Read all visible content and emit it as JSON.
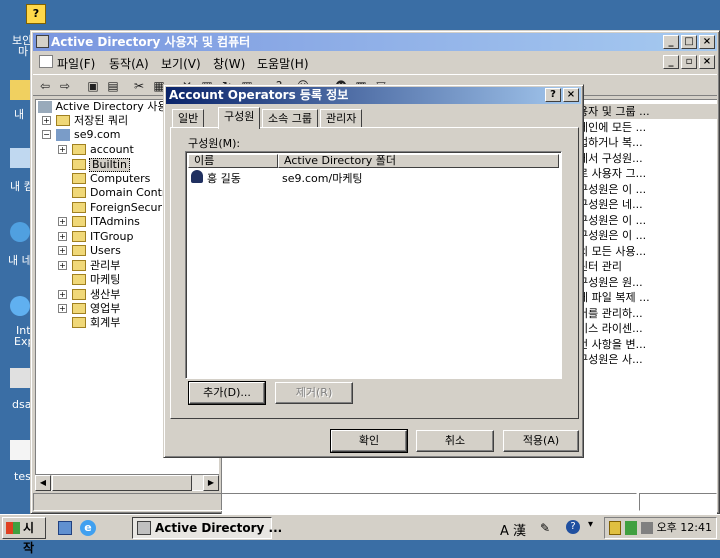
{
  "desktop": {
    "labels": [
      "보안",
      "마",
      "내",
      "내 컴",
      "내 네",
      "Int",
      "Exp",
      "dsa",
      "tes"
    ]
  },
  "mmc": {
    "title": "Active Directory 사용자 및 컴퓨터",
    "menu": [
      "파일(F)",
      "동작(A)",
      "보기(V)",
      "창(W)",
      "도움말(H)"
    ],
    "tree": {
      "root": "Active Directory 사용자",
      "saved_queries": "저장된 쿼리",
      "domain": "se9.com",
      "items": [
        "account",
        "Builtin",
        "Computers",
        "Domain Contro",
        "ForeignSecurit",
        "ITAdmins",
        "ITGroup",
        "Users",
        "관리부",
        "마케팅",
        "생산부",
        "영업부",
        "회계부"
      ]
    },
    "descriptions": [
      "용자 및 그룹 ...",
      "메인에 모든 ...",
      "업하거나 복...",
      "에서 구성원...",
      "로 사용자 그...",
      "구성원은 이 ...",
      "구성원은 네...",
      "구성원은 이 ...",
      "구성원은 이 ...",
      "의 모든 사용...",
      "린터 관리",
      "구성원은 원...",
      "에 파일 복제 ...",
      "버를 관리하...",
      "비스 라이센...",
      "번 사항을 변...",
      "구성원은 사..."
    ]
  },
  "dialog": {
    "title": "Account Operators 등록 정보",
    "help_button": "?",
    "close_button": "×",
    "tabs": [
      "일반",
      "구성원",
      "소속 그룹",
      "관리자"
    ],
    "members_label": "구성원(M):",
    "columns": [
      "이름",
      "Active Directory 폴더"
    ],
    "members": [
      {
        "name": "홍 길동",
        "folder": "se9.com/마케팅"
      }
    ],
    "add_button": "추가(D)...",
    "remove_button": "제거(R)",
    "ok_button": "확인",
    "cancel_button": "취소",
    "apply_button": "적용(A)"
  },
  "taskbar": {
    "start_label": "시작",
    "task_label": "Active Directory ...",
    "ime_label": "A 漢",
    "clock": "오후 12:41"
  },
  "colors": {
    "desktop": "#3a6ea5",
    "active_title": "#0a246a",
    "inactive_title": "#7a96df",
    "face": "#d4d0c8"
  }
}
